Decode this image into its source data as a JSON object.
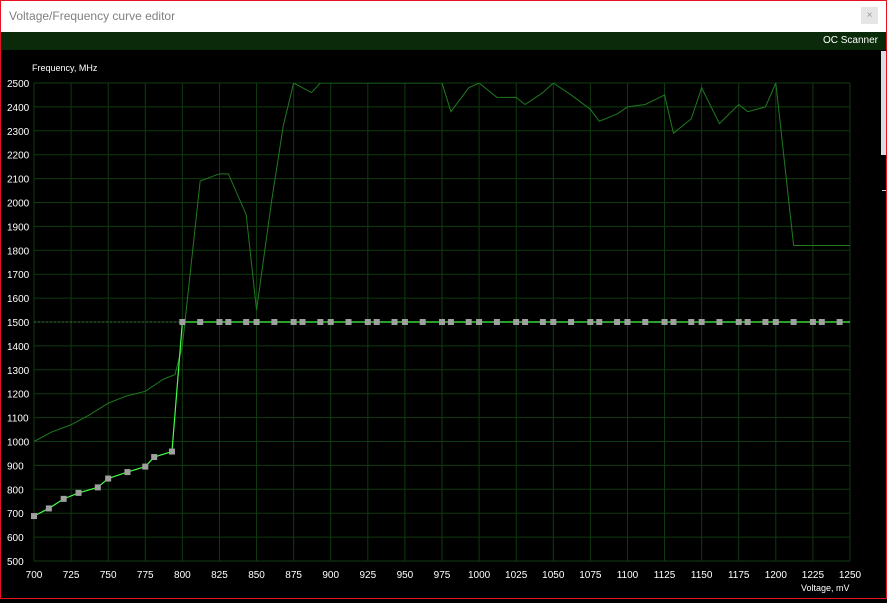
{
  "window": {
    "title": "Voltage/Frequency curve editor",
    "close_label": "×"
  },
  "toolbar": {
    "oc_scanner_label": "OC Scanner"
  },
  "colors": {
    "background": "#000000",
    "grid": "#0f3b0f",
    "curve": "#44ff44",
    "points": "#a0a0a0",
    "monitoring_line": "#1f7a1f",
    "toolbar": "#0a2a0a",
    "axis_text": "#ffffff"
  },
  "chart_data": {
    "type": "line",
    "xlabel": "Voltage, mV",
    "ylabel": "Frequency, MHz",
    "xlim": [
      700,
      1250
    ],
    "ylim": [
      500,
      2500
    ],
    "x_ticks": [
      700,
      725,
      750,
      775,
      800,
      825,
      850,
      875,
      900,
      925,
      950,
      975,
      1000,
      1025,
      1050,
      1075,
      1100,
      1125,
      1150,
      1175,
      1200,
      1225,
      1250
    ],
    "y_ticks": [
      500,
      600,
      700,
      800,
      900,
      1000,
      1100,
      1200,
      1300,
      1400,
      1500,
      1600,
      1700,
      1800,
      1900,
      2000,
      2100,
      2200,
      2300,
      2400,
      2500
    ],
    "dashed_reference_line": 1500,
    "series": [
      {
        "role": "vf-curve",
        "points": [
          [
            700,
            688
          ],
          [
            710,
            720
          ],
          [
            720,
            760
          ],
          [
            730,
            785
          ],
          [
            743,
            808
          ],
          [
            750,
            845
          ],
          [
            763,
            872
          ],
          [
            775,
            895
          ],
          [
            781,
            935
          ],
          [
            793,
            958
          ],
          [
            800,
            1500
          ],
          [
            812,
            1500
          ],
          [
            825,
            1500
          ],
          [
            831,
            1500
          ],
          [
            843,
            1500
          ],
          [
            850,
            1500
          ],
          [
            862,
            1500
          ],
          [
            875,
            1500
          ],
          [
            881,
            1500
          ],
          [
            893,
            1500
          ],
          [
            900,
            1500
          ],
          [
            912,
            1500
          ],
          [
            925,
            1500
          ],
          [
            931,
            1500
          ],
          [
            943,
            1500
          ],
          [
            950,
            1500
          ],
          [
            962,
            1500
          ],
          [
            975,
            1500
          ],
          [
            981,
            1500
          ],
          [
            993,
            1500
          ],
          [
            1000,
            1500
          ],
          [
            1012,
            1500
          ],
          [
            1025,
            1500
          ],
          [
            1031,
            1500
          ],
          [
            1043,
            1500
          ],
          [
            1050,
            1500
          ],
          [
            1062,
            1500
          ],
          [
            1075,
            1500
          ],
          [
            1081,
            1500
          ],
          [
            1093,
            1500
          ],
          [
            1100,
            1500
          ],
          [
            1112,
            1500
          ],
          [
            1125,
            1500
          ],
          [
            1131,
            1500
          ],
          [
            1143,
            1500
          ],
          [
            1150,
            1500
          ],
          [
            1162,
            1500
          ],
          [
            1175,
            1500
          ],
          [
            1181,
            1500
          ],
          [
            1193,
            1500
          ],
          [
            1200,
            1500
          ],
          [
            1212,
            1500
          ],
          [
            1225,
            1500
          ],
          [
            1231,
            1500
          ],
          [
            1243,
            1500
          ]
        ],
        "end_x": 1250
      },
      {
        "role": "monitoring-trace",
        "points": [
          [
            700,
            1000
          ],
          [
            712,
            1040
          ],
          [
            725,
            1070
          ],
          [
            737,
            1110
          ],
          [
            750,
            1160
          ],
          [
            762,
            1190
          ],
          [
            775,
            1210
          ],
          [
            787,
            1260
          ],
          [
            795,
            1280
          ],
          [
            800,
            1400
          ],
          [
            812,
            2090
          ],
          [
            825,
            2120
          ],
          [
            831,
            2120
          ],
          [
            843,
            1950
          ],
          [
            850,
            1550
          ],
          [
            860,
            2000
          ],
          [
            868,
            2320
          ],
          [
            875,
            2500
          ],
          [
            887,
            2460
          ],
          [
            893,
            2500
          ],
          [
            975,
            2500
          ],
          [
            981,
            2380
          ],
          [
            987,
            2430
          ],
          [
            993,
            2480
          ],
          [
            1000,
            2500
          ],
          [
            1012,
            2440
          ],
          [
            1025,
            2440
          ],
          [
            1031,
            2410
          ],
          [
            1043,
            2460
          ],
          [
            1050,
            2500
          ],
          [
            1062,
            2450
          ],
          [
            1075,
            2390
          ],
          [
            1081,
            2340
          ],
          [
            1093,
            2370
          ],
          [
            1100,
            2400
          ],
          [
            1112,
            2410
          ],
          [
            1125,
            2450
          ],
          [
            1131,
            2290
          ],
          [
            1143,
            2350
          ],
          [
            1150,
            2480
          ],
          [
            1162,
            2330
          ],
          [
            1175,
            2410
          ],
          [
            1181,
            2380
          ],
          [
            1193,
            2400
          ],
          [
            1200,
            2500
          ],
          [
            1212,
            1820
          ],
          [
            1225,
            1820
          ],
          [
            1231,
            1820
          ],
          [
            1250,
            1820
          ]
        ]
      }
    ]
  }
}
